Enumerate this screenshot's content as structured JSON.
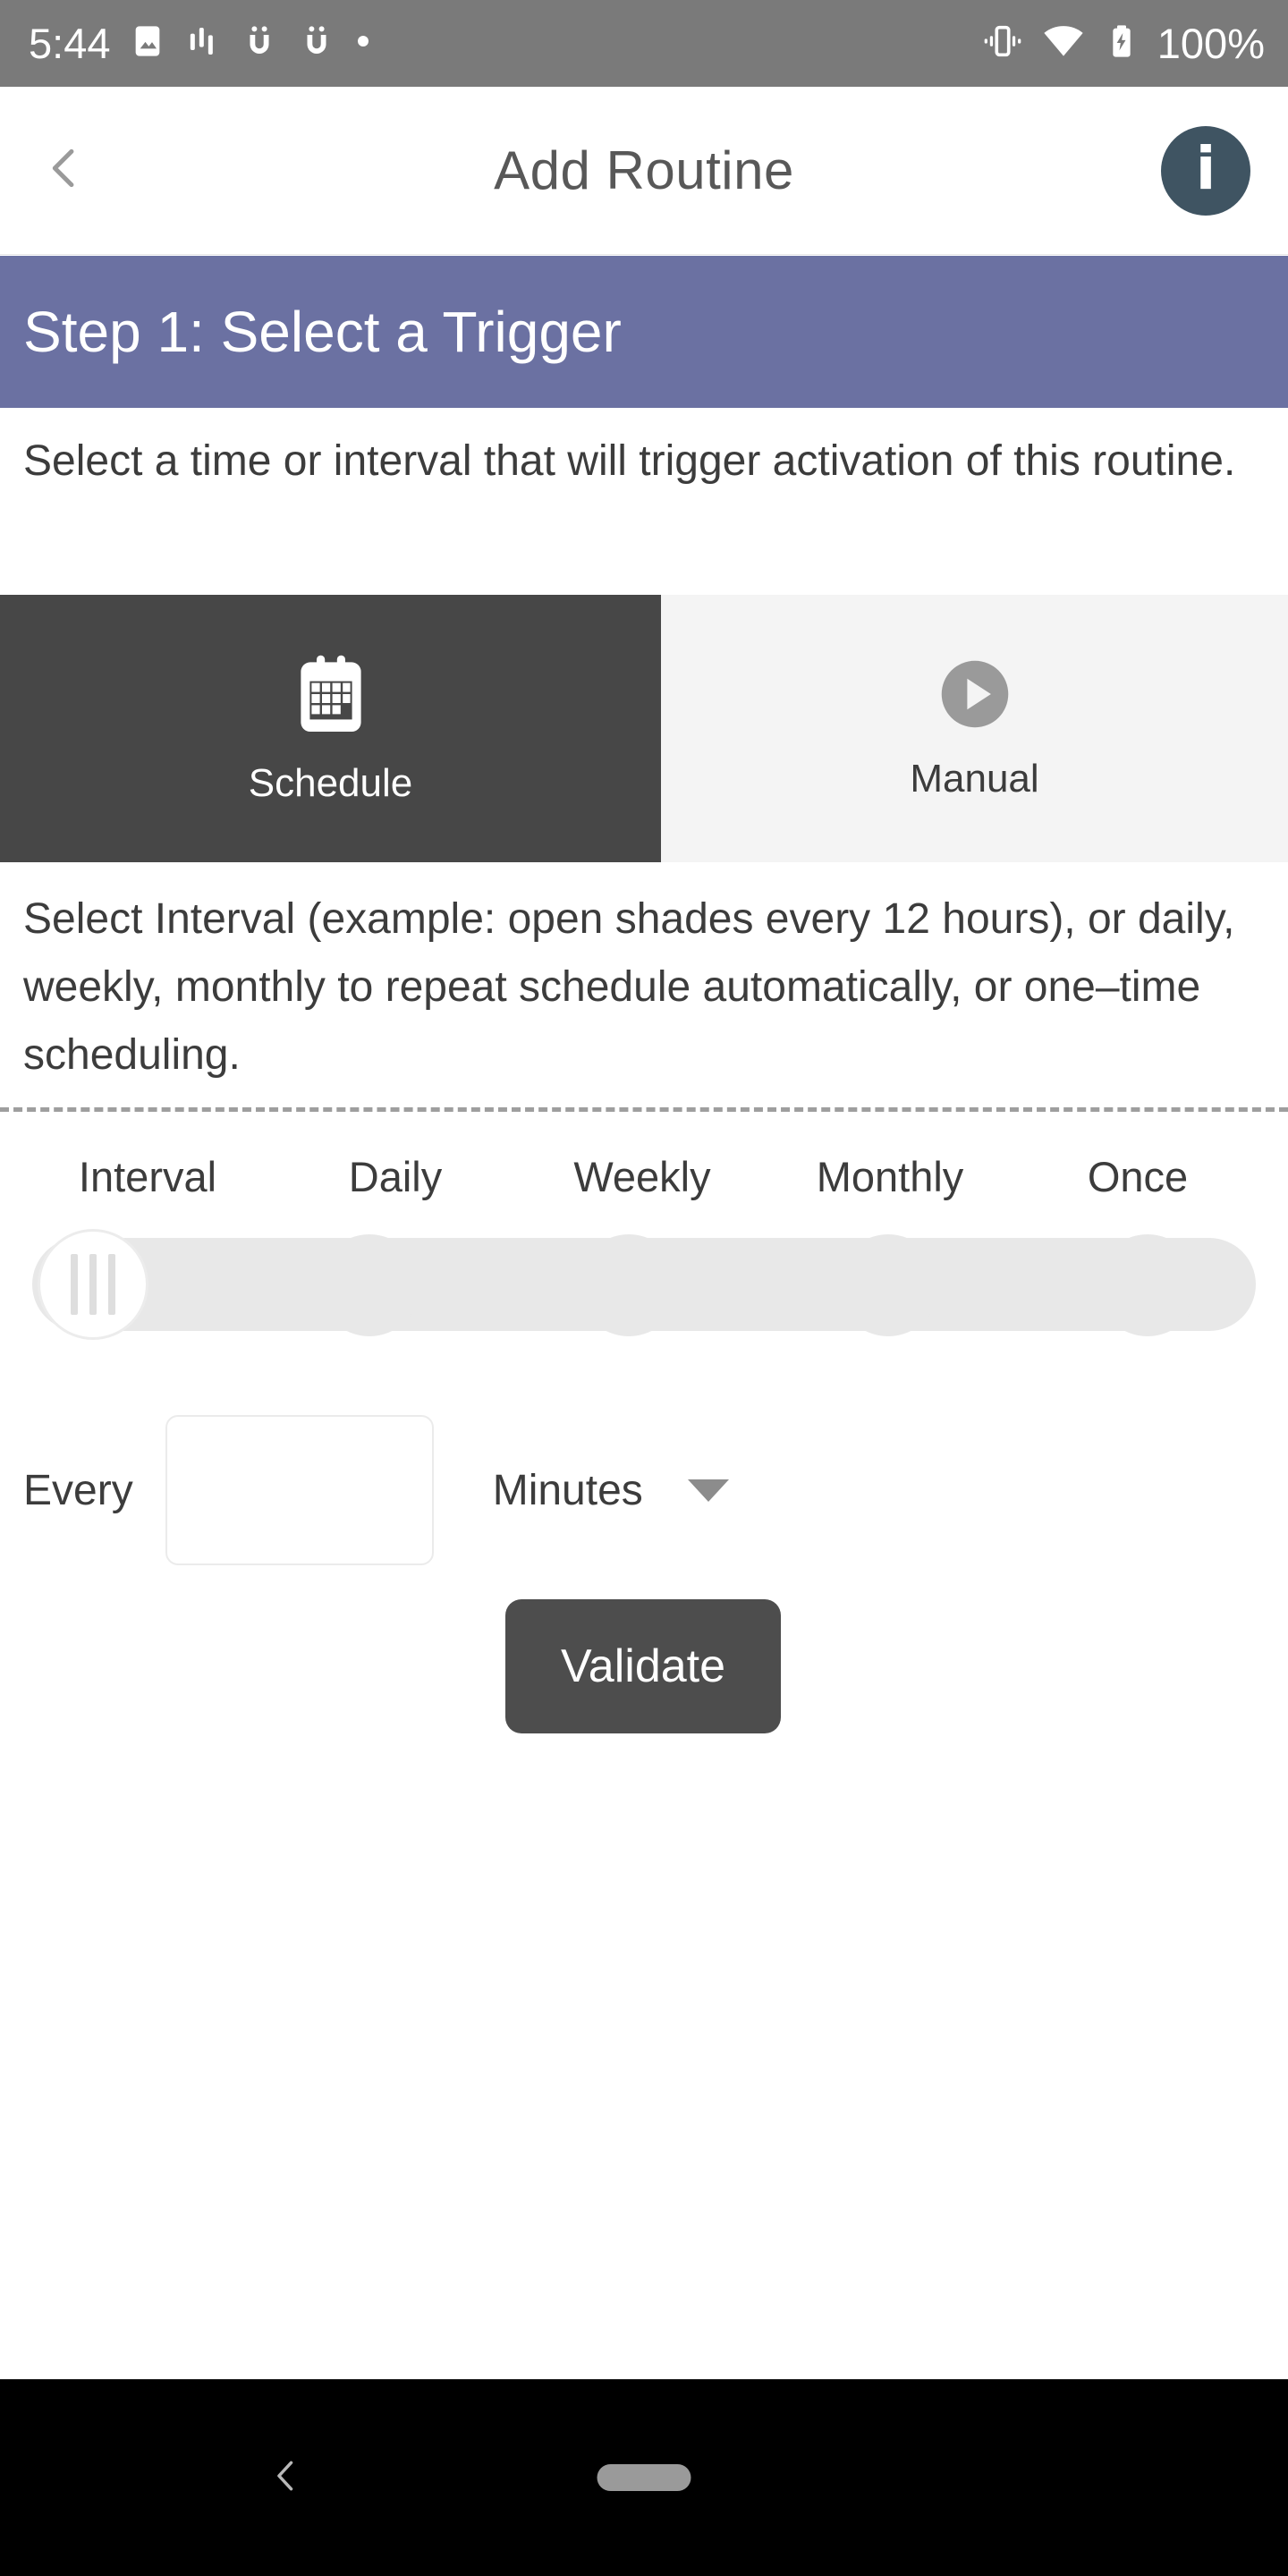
{
  "status_bar": {
    "time": "5:44",
    "battery_percent": "100%",
    "left_icons": [
      "image-icon",
      "equalizer-icon",
      "app-notification-icon",
      "app-notification-icon",
      "dot-icon"
    ],
    "right_icons": [
      "vibrate-icon",
      "wifi-icon",
      "battery-charging-icon"
    ],
    "background_color": "#7a7a7a"
  },
  "header": {
    "back_label": "back-chevron-icon",
    "title": "Add Routine",
    "info_label": "i"
  },
  "step_banner": {
    "text": "Step 1: Select a Trigger",
    "background_color": "#6b71a2"
  },
  "description": "Select a time or interval that will trigger activation of this routine.",
  "trigger_tabs": [
    {
      "label": "Schedule",
      "icon": "calendar-icon",
      "selected": true
    },
    {
      "label": "Manual",
      "icon": "play-circle-icon",
      "selected": false
    }
  ],
  "interval_description": "Select Interval (example: open shades every 12 hours), or daily, weekly, monthly to repeat schedule automatically, or one–time scheduling.",
  "schedule_slider": {
    "options": [
      "Interval",
      "Daily",
      "Weekly",
      "Monthly",
      "Once"
    ],
    "selected": "Interval",
    "selected_index": 0,
    "track_color": "#e8e8e8"
  },
  "every_row": {
    "label": "Every",
    "value": "",
    "placeholder": "",
    "unit": "Minutes",
    "caret": "chevron-down-icon"
  },
  "validate": {
    "label": "Validate",
    "background_color": "#4d4d4d"
  },
  "nav_bar": {
    "back": "back-icon",
    "home": "home-indicator"
  }
}
